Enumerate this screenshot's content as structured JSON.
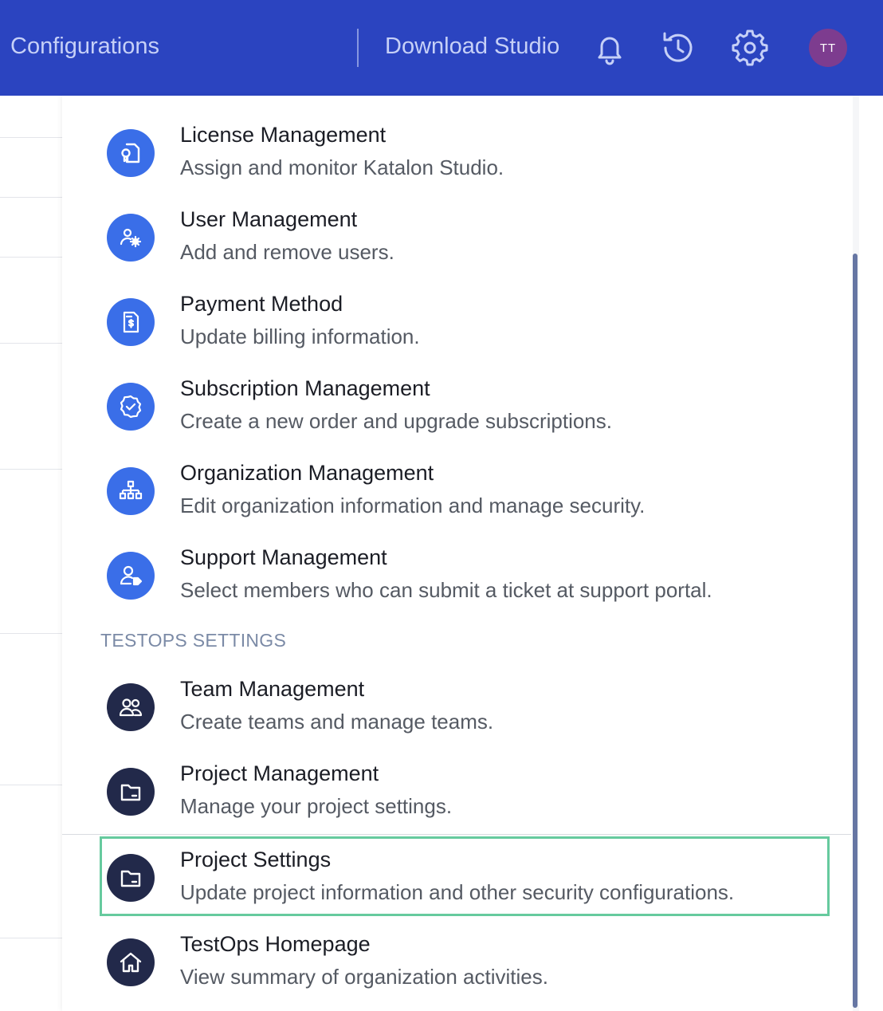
{
  "header": {
    "configurations": "Configurations",
    "download_studio": "Download Studio",
    "avatar_initials": "TT",
    "icons": [
      "bell-icon",
      "history-icon",
      "gear-icon"
    ],
    "colors": {
      "bar": "#2b44c0",
      "avatar": "#7d3c8f"
    }
  },
  "menu": {
    "account_items": [
      {
        "title": "License Management",
        "desc": "Assign and monitor Katalon Studio.",
        "icon": "license-icon"
      },
      {
        "title": "User Management",
        "desc": "Add and remove users.",
        "icon": "users-gear-icon"
      },
      {
        "title": "Payment Method",
        "desc": "Update billing information.",
        "icon": "invoice-icon"
      },
      {
        "title": "Subscription Management",
        "desc": "Create a new order and upgrade subscriptions.",
        "icon": "badge-check-icon"
      },
      {
        "title": "Organization Management",
        "desc": "Edit organization information and manage security.",
        "icon": "org-chart-icon"
      },
      {
        "title": "Support Management",
        "desc": "Select members who can submit a ticket at support portal.",
        "icon": "user-tag-icon"
      }
    ],
    "section_label": "TESTOPS SETTINGS",
    "testops_items": [
      {
        "title": "Team Management",
        "desc": "Create teams and manage teams.",
        "icon": "team-icon"
      },
      {
        "title": "Project Management",
        "desc": "Manage your project settings.",
        "icon": "folder-icon"
      },
      {
        "title": "Project Settings",
        "desc": "Update project information and other security configurations.",
        "icon": "folder-icon"
      },
      {
        "title": "TestOps Homepage",
        "desc": "View summary of organization activities.",
        "icon": "home-icon"
      }
    ],
    "highlighted_item": "Project Settings",
    "colors": {
      "account_icon_bg": "#3a6ee8",
      "testops_icon_bg": "#22294a",
      "highlight_border": "#66ca9e"
    }
  }
}
